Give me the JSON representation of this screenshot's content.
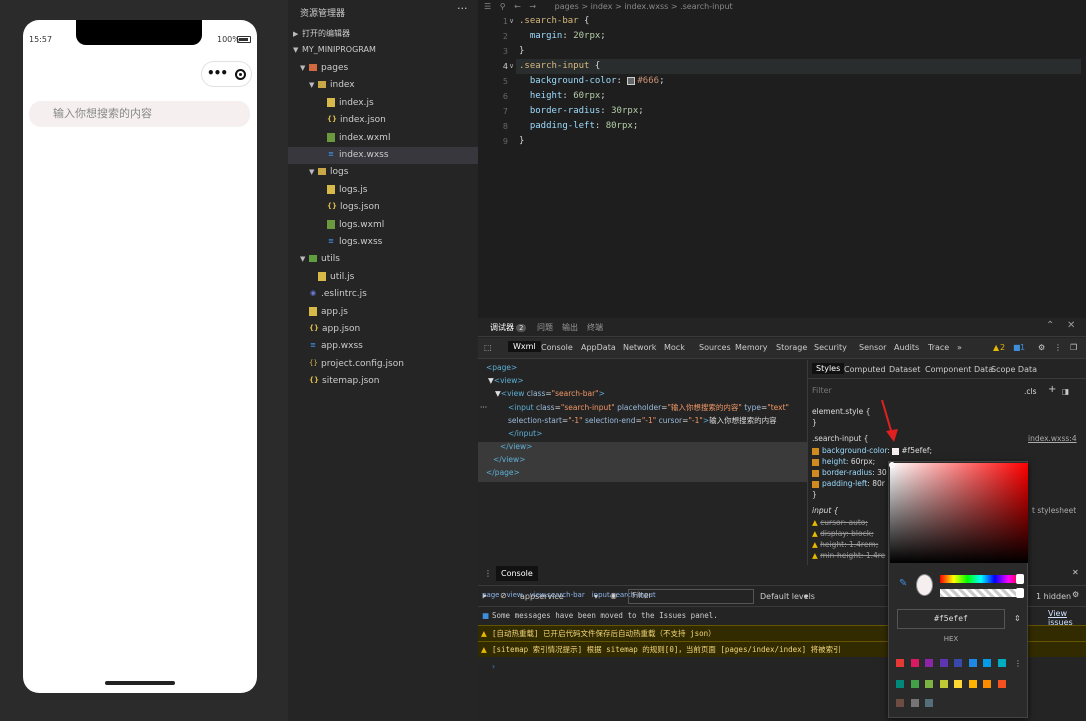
{
  "phone": {
    "time": "15:57",
    "battery": "100%",
    "search_placeholder": "输入你想搜索的内容"
  },
  "explorer": {
    "title": "资源管理器",
    "more": "···",
    "open_editors": "打开的编辑器",
    "project": "MY_MINIPROGRAM",
    "items": [
      {
        "label": "pages",
        "depth": 1,
        "kind": "foldp",
        "arrow": "▼"
      },
      {
        "label": "index",
        "depth": 2,
        "kind": "fold",
        "arrow": "▼"
      },
      {
        "label": "index.js",
        "depth": 3,
        "kind": "js"
      },
      {
        "label": "index.json",
        "depth": 3,
        "kind": "json"
      },
      {
        "label": "index.wxml",
        "depth": 3,
        "kind": "wxml"
      },
      {
        "label": "index.wxss",
        "depth": 3,
        "kind": "wxss",
        "selected": true
      },
      {
        "label": "logs",
        "depth": 2,
        "kind": "fold",
        "arrow": "▼"
      },
      {
        "label": "logs.js",
        "depth": 3,
        "kind": "js"
      },
      {
        "label": "logs.json",
        "depth": 3,
        "kind": "json"
      },
      {
        "label": "logs.wxml",
        "depth": 3,
        "kind": "wxml"
      },
      {
        "label": "logs.wxss",
        "depth": 3,
        "kind": "wxss"
      },
      {
        "label": "utils",
        "depth": 1,
        "kind": "foldu",
        "arrow": "▼"
      },
      {
        "label": "util.js",
        "depth": 2,
        "kind": "js"
      },
      {
        "label": ".eslintrc.js",
        "depth": 1,
        "kind": "lint"
      },
      {
        "label": "app.js",
        "depth": 1,
        "kind": "js"
      },
      {
        "label": "app.json",
        "depth": 1,
        "kind": "json"
      },
      {
        "label": "app.wxss",
        "depth": 1,
        "kind": "wxss"
      },
      {
        "label": "project.config.json",
        "depth": 1,
        "kind": "gear"
      },
      {
        "label": "sitemap.json",
        "depth": 1,
        "kind": "json"
      }
    ]
  },
  "editor": {
    "breadcrumbs": "pages  >  index  >  index.wxss  >  .search-input",
    "lines": [
      {
        "n": "1",
        "html": "<span class='sel-c'>.search-bar</span> <span class='pu'>{</span>"
      },
      {
        "n": "2",
        "html": "  <span class='prop'>margin</span><span class='pu'>:</span> <span class='num'>20rpx</span><span class='pu'>;</span>"
      },
      {
        "n": "3",
        "html": "<span class='pu'>}</span>"
      },
      {
        "n": "4",
        "html": "<span class='sel-c'>.search-input</span> <span class='pu'>{</span>",
        "cur": true
      },
      {
        "n": "5",
        "html": "  <span class='prop'>background-color</span><span class='pu'>:</span> <span class='sw'></span><span class='kw'>#666</span><span class='pu'>;</span>"
      },
      {
        "n": "6",
        "html": "  <span class='prop'>height</span><span class='pu'>:</span> <span class='num'>60rpx</span><span class='pu'>;</span>"
      },
      {
        "n": "7",
        "html": "  <span class='prop'>border-radius</span><span class='pu'>:</span> <span class='num'>30rpx</span><span class='pu'>;</span>"
      },
      {
        "n": "8",
        "html": "  <span class='prop'>padding-left</span><span class='pu'>:</span> <span class='num'>80rpx</span><span class='pu'>;</span>"
      },
      {
        "n": "9",
        "html": "<span class='pu'>}</span>"
      }
    ]
  },
  "panel": {
    "tabs": [
      "调试器",
      "问题",
      "输出",
      "终端"
    ],
    "debugger_badge": "2",
    "devtools_tabs": [
      "Wxml",
      "Console",
      "AppData",
      "Network",
      "Mock",
      "Sources",
      "Memory",
      "Storage",
      "Security",
      "Sensor",
      "Audits",
      "Trace"
    ],
    "more": "»",
    "warn_count": "2",
    "info_count": "1",
    "path": [
      "page",
      "view",
      "view.search-bar",
      "input.search-input"
    ]
  },
  "styles": {
    "tabs": [
      "Styles",
      "Computed",
      "Dataset",
      "Component Data",
      "Scope Data"
    ],
    "filter_placeholder": "Filter",
    "cls": ".cls",
    "element_style": "element.style {",
    "rule_selector": ".search-input {",
    "rule_source": "index.wxss:4",
    "new_value": "#f5efef;",
    "ua_selector": "input {",
    "ua_source": "t stylesheet"
  },
  "console": {
    "tab": "Console",
    "context": "appservice",
    "filter": "Filter",
    "levels": "Default levels",
    "hidden": "1 hidden",
    "issues_link": "View issues",
    "messages": [
      {
        "type": "info",
        "text": "Some messages have been moved to the Issues panel."
      },
      {
        "type": "warn",
        "text": "[自动热重载] 已开启代码文件保存后自动热重载（不支持 json）"
      },
      {
        "type": "warn",
        "text": "[sitemap 索引情况提示] 根据 sitemap 的规则[0]，当前页面 [pages/index/index] 将被索引"
      }
    ]
  },
  "picker": {
    "hex": "#f5efef",
    "hex_label": "HEX",
    "swatches_row1": [
      "#e53935",
      "#d81b60",
      "#8e24aa",
      "#5e35b1",
      "#3949ab",
      "#1e88e5",
      "#039be5",
      "#00acc1"
    ],
    "swatches_row2": [
      "#00897b",
      "#43a047",
      "#7cb342",
      "#c0ca33",
      "#fdd835",
      "#ffb300",
      "#fb8c00",
      "#f4511e"
    ],
    "swatches_row3": [
      "#6d4c41",
      "#757575",
      "#546e7a"
    ]
  }
}
